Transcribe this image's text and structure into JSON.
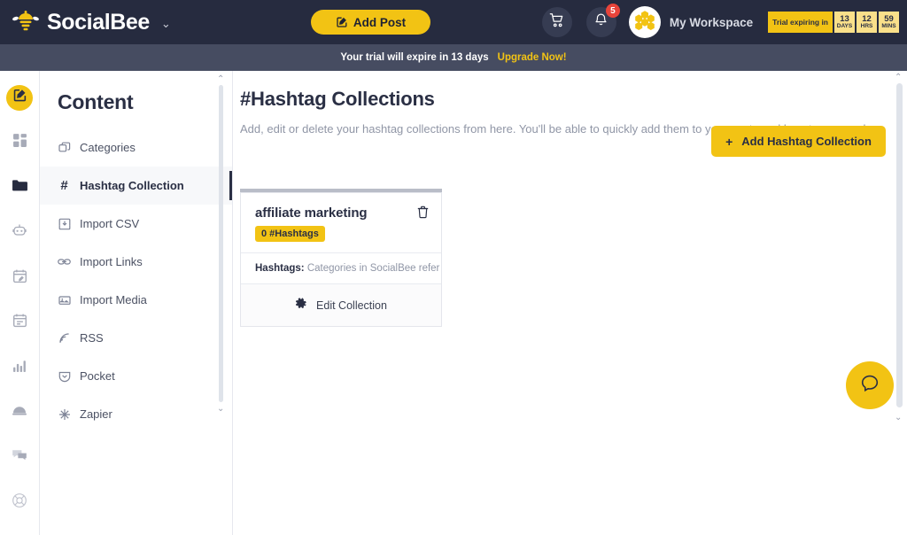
{
  "header": {
    "brand": "SocialBee",
    "brand_caret": "⌄",
    "add_post_label": "Add Post",
    "cart_icon": "cart-icon",
    "bell_icon": "bell-icon",
    "notification_count": "5",
    "workspace_name": "My Workspace",
    "trial": {
      "label": "Trial expiring in",
      "units": [
        {
          "num": "13",
          "lbl": "DAYS"
        },
        {
          "num": "12",
          "lbl": "HRS"
        },
        {
          "num": "59",
          "lbl": "MINS"
        }
      ]
    },
    "colors": {
      "bg": "#262b3f",
      "accent": "#f2c314",
      "badge": "#e8443a"
    }
  },
  "banner": {
    "text": "Your trial will expire in 13 days",
    "link": "Upgrade Now!",
    "bg": "#464c61",
    "link_color": "#f2c314"
  },
  "rail": {
    "items": [
      {
        "icon": "compose-icon",
        "active": true
      },
      {
        "icon": "dashboard-icon",
        "active": false
      },
      {
        "icon": "folder-icon",
        "active": false
      },
      {
        "icon": "bot-icon",
        "active": false
      },
      {
        "icon": "calendar-edit-icon",
        "active": false
      },
      {
        "icon": "calendar-icon",
        "active": false
      },
      {
        "icon": "analytics-icon",
        "active": false
      },
      {
        "icon": "bell-dome-icon",
        "active": false
      },
      {
        "icon": "chat-icon",
        "active": false
      },
      {
        "icon": "lifebuoy-icon",
        "active": false
      }
    ]
  },
  "sidebar": {
    "title": "Content",
    "scroll_up": "⌃",
    "scroll_down": "⌄",
    "items": [
      {
        "label": "Categories",
        "icon": "copy-icon",
        "active": false
      },
      {
        "label": "Hashtag Collection",
        "icon": "hash-icon",
        "active": true
      },
      {
        "label": "Import CSV",
        "icon": "download-box-icon",
        "active": false
      },
      {
        "label": "Import Links",
        "icon": "link-icon",
        "active": false
      },
      {
        "label": "Import Media",
        "icon": "image-icon",
        "active": false
      },
      {
        "label": "RSS",
        "icon": "rss-icon",
        "active": false
      },
      {
        "label": "Pocket",
        "icon": "pocket-icon",
        "active": false
      },
      {
        "label": "Zapier",
        "icon": "zapier-icon",
        "active": false
      }
    ]
  },
  "main": {
    "title": "#Hashtag Collections",
    "description": "Add, edit or delete your hashtag collections from here. You'll be able to quickly add them to your posts and boost your reach.",
    "add_button_label": "Add Hashtag Collection",
    "add_button_plus": "+",
    "card": {
      "title": "affiliate marketing",
      "pill": "0 #Hashtags",
      "body_label": "Hashtags:",
      "body_text": "Categories in SocialBee refer t...",
      "edit_label": "Edit Collection",
      "trash_icon": "trash-icon",
      "gear_icon": "gear-icon"
    }
  },
  "help": {
    "icon": "chat-bubble-icon",
    "color": "#f2c314"
  },
  "scrollbars": {
    "up": "⌃",
    "down": "⌄"
  }
}
